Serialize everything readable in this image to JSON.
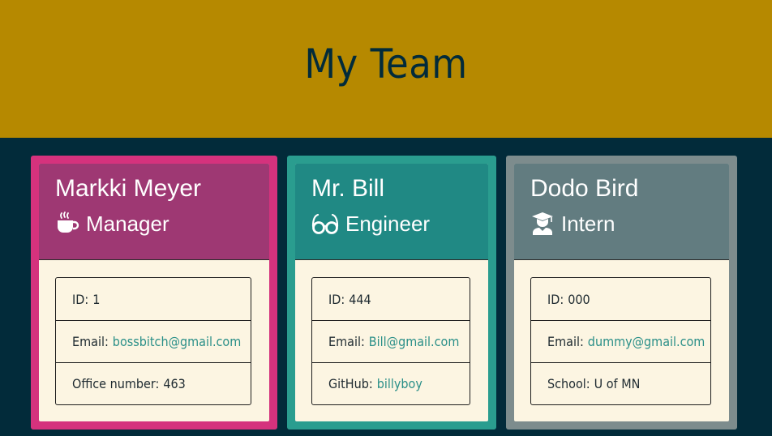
{
  "header": {
    "title": "My Team"
  },
  "cards": [
    {
      "name": "Markki Meyer",
      "role": "Manager",
      "icon": "coffee-icon",
      "accent": "#d5327d",
      "head_bg": "#9e3873",
      "id_label": "ID:",
      "id": "1",
      "email_label": "Email:",
      "email": "bossbitch@gmail.com",
      "extra_label": "Office number:",
      "extra": "463"
    },
    {
      "name": "Mr. Bill",
      "role": "Engineer",
      "icon": "glasses-icon",
      "accent": "#2a9d8f",
      "head_bg": "#208984",
      "id_label": "ID:",
      "id": "444",
      "email_label": "Email:",
      "email": "Bill@gmail.com",
      "extra_label": "GitHub:",
      "extra": "billyboy"
    },
    {
      "name": "Dodo Bird",
      "role": "Intern",
      "icon": "graduate-icon",
      "accent": "#7d8c8d",
      "head_bg": "#627c80",
      "id_label": "ID:",
      "id": "000",
      "email_label": "Email:",
      "email": "dummy@gmail.com",
      "extra_label": "School:",
      "extra": "U of MN"
    }
  ]
}
